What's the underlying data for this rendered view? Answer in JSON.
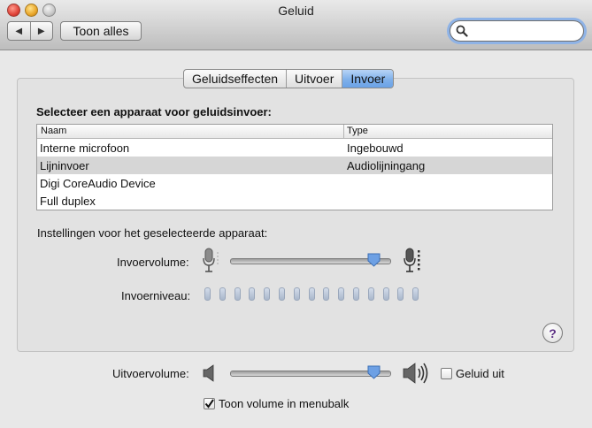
{
  "window": {
    "title": "Geluid"
  },
  "toolbar": {
    "show_all_label": "Toon alles",
    "search": {
      "value": "",
      "placeholder": ""
    }
  },
  "tabs": [
    {
      "label": "Geluidseffecten",
      "active": false
    },
    {
      "label": "Uitvoer",
      "active": false
    },
    {
      "label": "Invoer",
      "active": true
    }
  ],
  "input": {
    "heading": "Selecteer een apparaat voor geluidsinvoer:",
    "columns": [
      "Naam",
      "Type"
    ],
    "devices": [
      {
        "name": "Interne microfoon",
        "type": "Ingebouwd",
        "selected": false
      },
      {
        "name": "Lijninvoer",
        "type": "Audiolijningang",
        "selected": true
      },
      {
        "name": "Digi CoreAudio Device",
        "type": "",
        "selected": false
      },
      {
        "name": "Full duplex",
        "type": "",
        "selected": false
      }
    ],
    "settings_heading": "Instellingen voor het geselecteerde apparaat:",
    "volume_label": "Invoervolume:",
    "volume_level": 0.9,
    "level_label": "Invoerniveau:",
    "level_segments": 15,
    "level_active": 0
  },
  "output": {
    "volume_label": "Uitvoervolume:",
    "volume_level": 0.9,
    "mute_label": "Geluid uit",
    "mute_checked": false,
    "menubar_label": "Toon volume in menubalk",
    "menubar_checked": true
  },
  "icons": [
    "back-icon",
    "forward-icon",
    "search-icon",
    "microphone-low-icon",
    "microphone-high-icon",
    "speaker-low-icon",
    "speaker-high-icon",
    "help-icon"
  ],
  "colors": {
    "selected_tab": "#7fb0ea",
    "selected_row": "#d6d6d6",
    "focus_ring": "#8fb3e6",
    "help_mark": "#5a2d82"
  }
}
